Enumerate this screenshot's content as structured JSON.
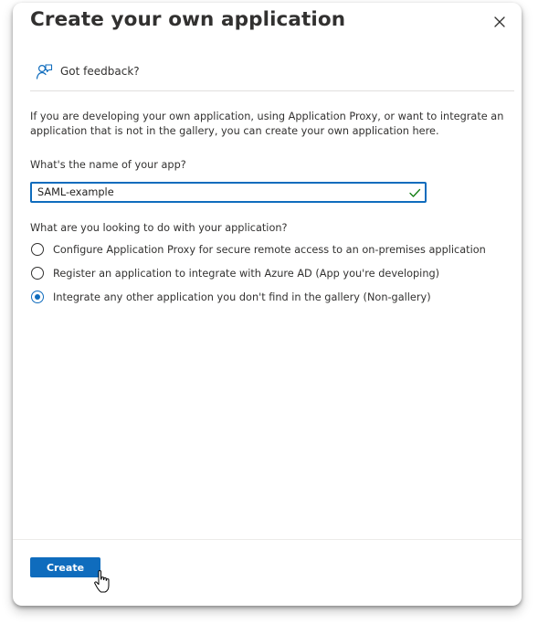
{
  "dialog": {
    "title": "Create your own application",
    "close_icon": "close-icon"
  },
  "feedback": {
    "label": "Got feedback?",
    "icon": "feedback-person-icon"
  },
  "description": "If you are developing your own application, using Application Proxy, or want to integrate an application that is not in the gallery, you can create your own application here.",
  "app_name": {
    "label": "What's the name of your app?",
    "value": "SAML-example",
    "valid_icon": "checkmark-icon"
  },
  "purpose": {
    "question": "What are you looking to do with your application?",
    "options": [
      {
        "label": "Configure Application Proxy for secure remote access to an on-premises application",
        "selected": false
      },
      {
        "label": "Register an application to integrate with Azure AD (App you're developing)",
        "selected": false
      },
      {
        "label": "Integrate any other application you don't find in the gallery (Non-gallery)",
        "selected": true
      }
    ]
  },
  "footer": {
    "create_label": "Create"
  },
  "colors": {
    "accent": "#0f6cbd",
    "valid": "#107c10",
    "text": "#323130"
  }
}
